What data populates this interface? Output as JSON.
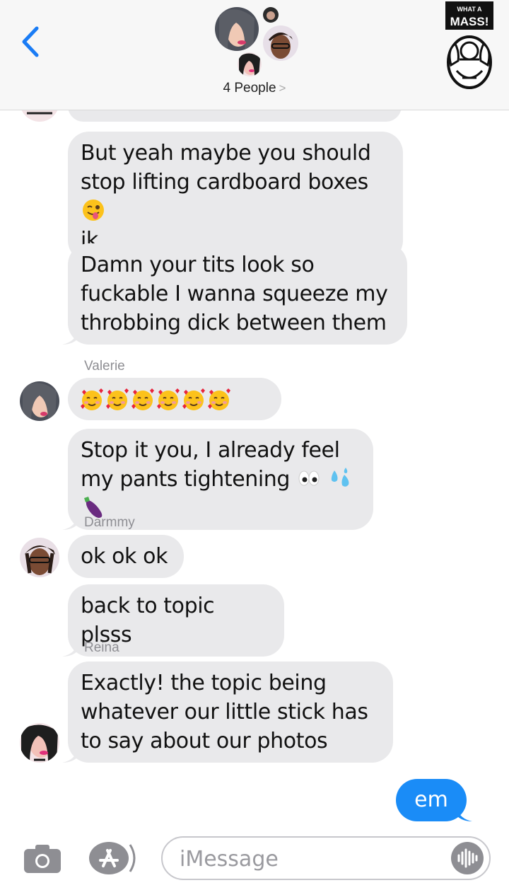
{
  "header": {
    "back_icon": "chevron-left-icon",
    "people_label": "4 People",
    "people_chevron": ">",
    "badge": {
      "line1": "WHAT A",
      "line2": "MASS!"
    }
  },
  "messages": [
    {
      "type": "in",
      "text": "But yeah maybe you should stop lifting cardboard boxes",
      "suffix": "jk",
      "emoji": [
        "winking-face-with-tongue"
      ]
    },
    {
      "type": "in",
      "text": "Damn your tits look so fuckable I wanna squeeze my throbbing dick between them"
    },
    {
      "type": "sender",
      "name": "Valerie"
    },
    {
      "type": "in",
      "emoji": [
        "smiling-face-with-hearts",
        "smiling-face-with-hearts",
        "smiling-face-with-hearts",
        "smiling-face-with-hearts",
        "smiling-face-with-hearts",
        "smiling-face-with-hearts"
      ]
    },
    {
      "type": "in",
      "text": "Stop it you, I already feel my pants tightening",
      "emoji": [
        "eyes",
        "sweat-droplets",
        "eggplant"
      ]
    },
    {
      "type": "sender",
      "name": "Darmmy"
    },
    {
      "type": "in",
      "text": "ok ok ok"
    },
    {
      "type": "in",
      "text": "back to topic plsss"
    },
    {
      "type": "sender",
      "name": "Reina"
    },
    {
      "type": "in",
      "text": "Exactly! the topic being whatever our little stick has to say about our photos"
    },
    {
      "type": "out",
      "text": "em"
    }
  ],
  "input": {
    "placeholder": "iMessage",
    "camera_icon": "camera-icon",
    "apps_icon": "app-store-icon",
    "audio_icon": "audio-waveform-icon"
  },
  "colors": {
    "incoming": "#e9e9eb",
    "outgoing": "#1a8cf7",
    "link": "#1a7cf5"
  }
}
